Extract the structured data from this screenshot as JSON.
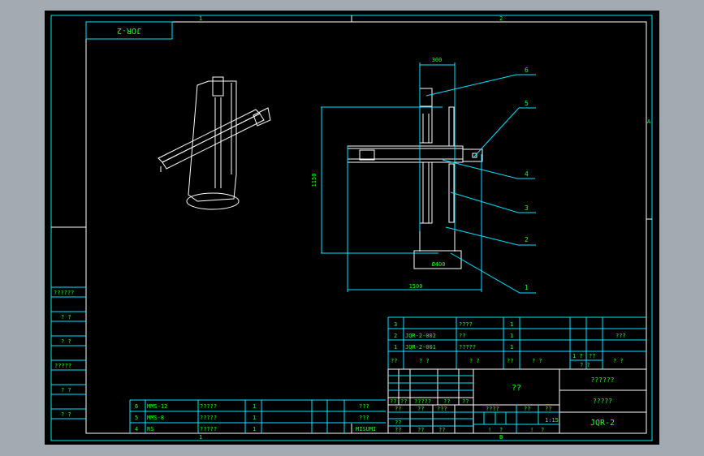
{
  "drawing": {
    "title_tag": "JOR-2",
    "zone_marks": {
      "top_left": "1",
      "top_right": "2",
      "right": "A",
      "bottom_left": "1",
      "bottom_right": "B"
    },
    "dimensions": {
      "top_width": "300",
      "height": "1150",
      "base": "Ø400",
      "overall_width": "1500"
    },
    "balloons": [
      "6",
      "5",
      "4",
      "3",
      "2",
      "1"
    ]
  },
  "left_column": [
    "??????",
    "? ?",
    "? ?",
    "?????",
    "? ?",
    "? ?"
  ],
  "parts_list_upper": [
    {
      "no": "3",
      "code": "",
      "name": "????",
      "qty": "1",
      "remark": ""
    },
    {
      "no": "2",
      "code": "JQR-2-002",
      "name": "??",
      "qty": "1",
      "remark": "???"
    },
    {
      "no": "1",
      "code": "JQR-2-001",
      "name": "?????",
      "qty": "1",
      "remark": ""
    }
  ],
  "parts_header": [
    "??",
    "? ?",
    "? ?",
    "??",
    "? ?",
    "1 ?",
    "??",
    "? ?",
    "? ?"
  ],
  "parts_list_lower": [
    {
      "no": "6",
      "code": "MMS-12",
      "name": "?????",
      "qty": "1",
      "source": "???"
    },
    {
      "no": "5",
      "code": "MMS-8",
      "name": "?????",
      "qty": "1",
      "source": "???"
    },
    {
      "no": "4",
      "code": "RS",
      "name": "?????",
      "qty": "1",
      "source": "MISUMI"
    }
  ],
  "title_block": {
    "material": "??",
    "company": "??????",
    "drawing_name": "?????",
    "drawing_no": "JQR-2",
    "scale": "1:15",
    "sign_labels": [
      "??",
      "??",
      "?????",
      "??",
      "??"
    ],
    "stage_labels": [
      "??",
      "??",
      "???"
    ],
    "review_labels": [
      "??",
      "??"
    ],
    "extra_labels": [
      "??",
      "??"
    ],
    "stage_row": [
      "????",
      "??",
      "??"
    ],
    "sheet_row": [
      "!",
      "?",
      "!",
      "?"
    ]
  }
}
